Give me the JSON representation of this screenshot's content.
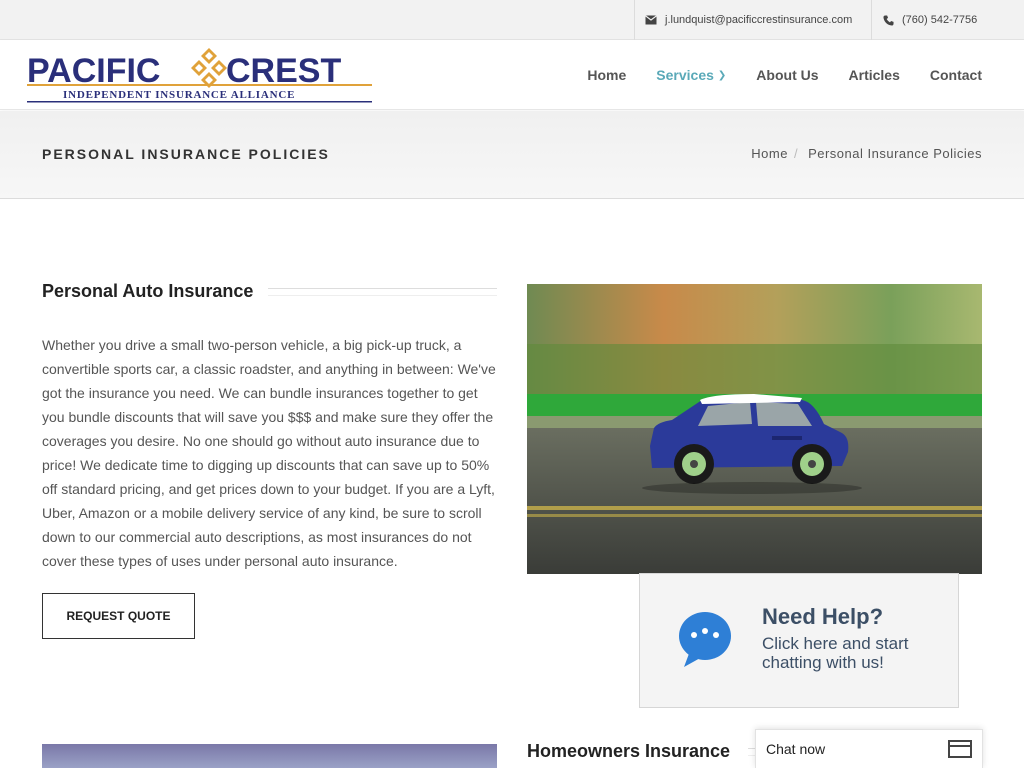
{
  "topbar": {
    "email": "j.lundquist@pacificcrestinsurance.com",
    "phone": "(760) 542-7756"
  },
  "logo": {
    "name_left": "PACIFIC",
    "name_right": "CREST",
    "tagline": "INDEPENDENT INSURANCE ALLIANCE"
  },
  "nav": {
    "items": [
      {
        "label": "Home"
      },
      {
        "label": "Services"
      },
      {
        "label": "About Us"
      },
      {
        "label": "Articles"
      },
      {
        "label": "Contact"
      }
    ]
  },
  "page": {
    "title": "PERSONAL INSURANCE POLICIES",
    "breadcrumb": [
      "Home",
      "Personal Insurance Policies"
    ]
  },
  "sections": {
    "auto": {
      "title": "Personal Auto Insurance",
      "body": "Whether you drive a small two-person vehicle, a big pick-up truck, a convertible sports car, a classic roadster, and anything in between: We've got the insurance you need. We can bundle insurances together to get you bundle discounts that will save you $$$ and make sure they offer the coverages you desire. No one should go without auto insurance due to price! We dedicate time to digging up discounts that can save up to 50% off standard pricing, and get prices down to your budget. If you are a Lyft, Uber, Amazon or a mobile delivery service of any kind, be sure to scroll down to our commercial auto descriptions, as most insurances do not cover these types of uses under personal auto insurance.",
      "button": "REQUEST QUOTE"
    },
    "home": {
      "title": "Homeowners Insurance"
    }
  },
  "help_widget": {
    "title": "Need Help?",
    "line1": "Click here and start",
    "line2": "chatting with us!"
  },
  "chat": {
    "label": "Chat now"
  },
  "colors": {
    "accent": "#5aa9b8",
    "logo_navy": "#2a2f7a",
    "logo_gold": "#e0a23a"
  }
}
